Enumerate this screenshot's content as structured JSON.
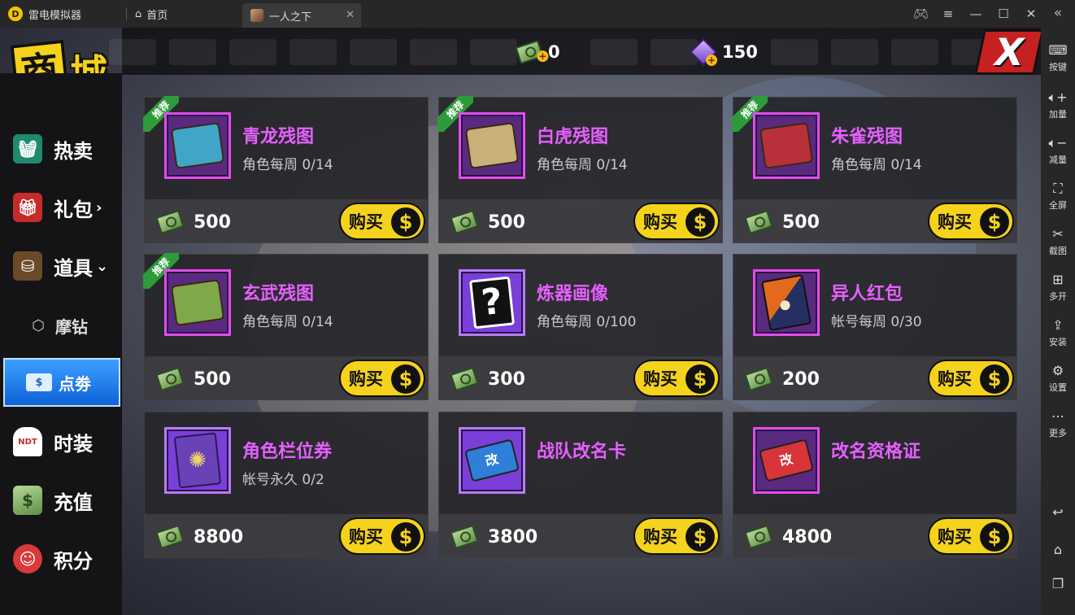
{
  "titlebar": {
    "app_name": "雷电模拟器",
    "home_tab": "首页",
    "game_tab": "一人之下"
  },
  "rsidebar": {
    "items": [
      {
        "label": "按键",
        "icon": "keyboard-icon"
      },
      {
        "label": "加量",
        "icon": "volume-up-icon"
      },
      {
        "label": "减量",
        "icon": "volume-down-icon"
      },
      {
        "label": "全屏",
        "icon": "fullscreen-icon"
      },
      {
        "label": "截图",
        "icon": "scissors-icon"
      },
      {
        "label": "多开",
        "icon": "multi-instance-icon"
      },
      {
        "label": "安装",
        "icon": "install-icon"
      },
      {
        "label": "设置",
        "icon": "gear-icon"
      },
      {
        "label": "更多",
        "icon": "more-icon"
      }
    ]
  },
  "shop": {
    "title_char1": "商",
    "title_char2": "城",
    "close_label": "X",
    "cash_amount": "0",
    "gem_amount": "150"
  },
  "menu": {
    "hot": "热卖",
    "gift": "礼包",
    "gift_arrow": "›",
    "props": "道具",
    "props_arrow": "⌄",
    "mozuan": "摩钻",
    "dianquan": "点劵",
    "fashion": "时装",
    "recharge": "充值",
    "points": "积分"
  },
  "buy_label": "购买",
  "coin_symbol": "$",
  "badge_label": "推荐",
  "items": [
    {
      "name": "青龙残图",
      "limit": "角色每周  0/14",
      "price": "500",
      "recommended": true,
      "art_color": "#3fa6c8"
    },
    {
      "name": "白虎残图",
      "limit": "角色每周  0/14",
      "price": "500",
      "recommended": true,
      "art_color": "#c9b07a"
    },
    {
      "name": "朱雀残图",
      "limit": "角色每周  0/14",
      "price": "500",
      "recommended": true,
      "art_color": "#b8303a"
    },
    {
      "name": "玄武残图",
      "limit": "角色每周  0/14",
      "price": "500",
      "recommended": true,
      "art_color": "#7fa84a"
    },
    {
      "name": "炼器画像",
      "limit": "角色每周  0/100",
      "price": "300",
      "recommended": false,
      "art_text": "?"
    },
    {
      "name": "异人红包",
      "limit": "帐号每周  0/30",
      "price": "200",
      "recommended": false
    },
    {
      "name": "角色栏位券",
      "limit": "帐号永久  0/2",
      "price": "8800",
      "recommended": false,
      "art_text": "✺"
    },
    {
      "name": "战队改名卡",
      "limit": "",
      "price": "3800",
      "recommended": false,
      "art_text": "改",
      "art_color": "#2f7fd8"
    },
    {
      "name": "改名资格证",
      "limit": "",
      "price": "4800",
      "recommended": false,
      "art_text": "改",
      "art_color": "#d8343a"
    }
  ]
}
